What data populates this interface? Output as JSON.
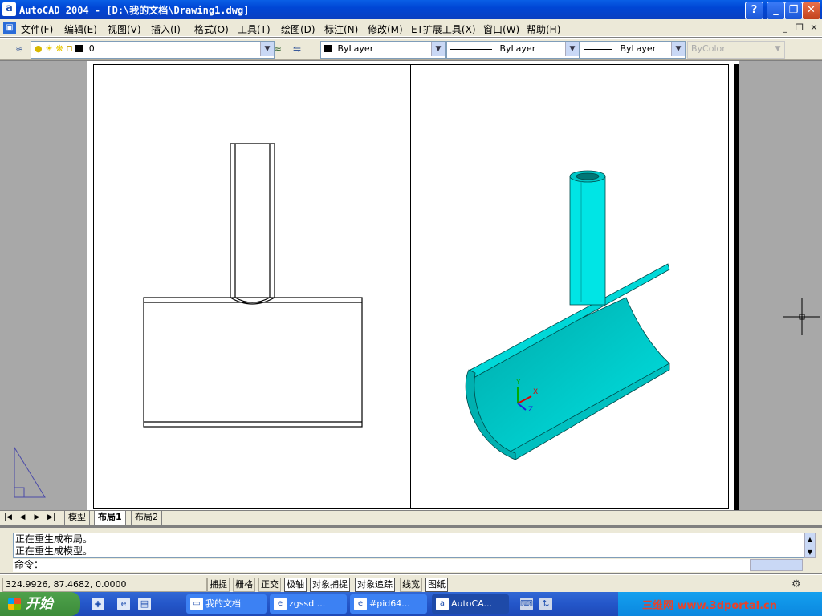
{
  "window": {
    "title": "AutoCAD 2004 - [D:\\我的文档\\Drawing1.dwg]",
    "app_icon": "a",
    "buttons": {
      "help": "?",
      "minimize": "_",
      "restore": "❐",
      "close": "✕"
    }
  },
  "menu": {
    "items": [
      "文件(F)",
      "编辑(E)",
      "视图(V)",
      "插入(I)",
      "格式(O)",
      "工具(T)",
      "绘图(D)",
      "标注(N)",
      "修改(M)",
      "ET扩展工具(X)",
      "窗口(W)",
      "帮助(H)"
    ],
    "mdi": {
      "minimize": "_",
      "restore": "❐",
      "close": "✕"
    }
  },
  "toolbar": {
    "layer_value": "0",
    "color_value": "ByLayer",
    "linetype_value": "ByLayer",
    "lineweight_value": "ByLayer",
    "plotstyle_value": "ByColor"
  },
  "layout_tabs": {
    "nav": [
      "|◀",
      "◀",
      "▶",
      "▶|"
    ],
    "tabs": [
      "模型",
      "布局1",
      "布局2"
    ],
    "active": "布局1"
  },
  "command": {
    "history": [
      "正在重生成布局。",
      "正在重生成模型。"
    ],
    "prompt": "命令："
  },
  "status": {
    "coords": "324.9926, 87.4682, 0.0000",
    "buttons": [
      "捕捉",
      "栅格",
      "正交",
      "极轴",
      "对象捕捉",
      "对象追踪",
      "线宽",
      "图纸"
    ],
    "on_buttons": [
      "极轴",
      "对象捕捉",
      "对象追踪",
      "图纸"
    ]
  },
  "taskbar": {
    "start_label": "开始",
    "tasks": [
      "我的文档",
      "zgssd ...",
      "#pid64...",
      "AutoCA..."
    ],
    "active_task": "AutoCA...",
    "watermark": "三维网 www.3dportal.cn"
  },
  "ucs_axes": {
    "x": "X",
    "y": "Y",
    "z": "Z"
  },
  "colors": {
    "model_cyan": "#00e5e5",
    "title_blue": "#0a5fe6",
    "taskbar_blue": "#2456c9"
  }
}
